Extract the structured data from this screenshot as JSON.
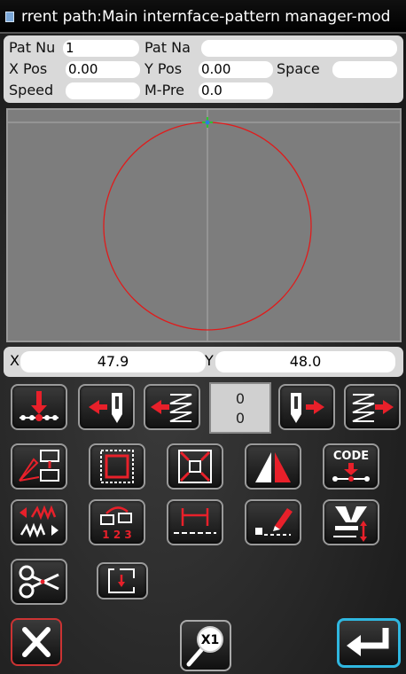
{
  "title": "rrent path:Main internface-pattern manager-mod",
  "params": {
    "pat_num_label": "Pat Nu",
    "pat_num_value": "1",
    "pat_name_label": "Pat Na",
    "pat_name_value": "",
    "x_pos_label": "X Pos",
    "x_pos_value": "0.00",
    "y_pos_label": "Y Pos",
    "y_pos_value": "0.00",
    "space_label": "Space",
    "space_value": "",
    "speed_label": "Speed",
    "speed_value": "",
    "m_pre_label": "M-Pre",
    "m_pre_value": "0.0"
  },
  "coords": {
    "x_label": "X",
    "x_value": "47.9",
    "y_label": "Y",
    "y_value": "48.0"
  },
  "counter": {
    "top": "0",
    "bottom": "0"
  },
  "code_button_label": "CODE",
  "zoom_label": "X1",
  "colors": {
    "pattern": "#e01b1b",
    "accent_red": "#e8202a",
    "accent_cyan": "#2fb7e0",
    "canvas": "#7d7d7d"
  }
}
